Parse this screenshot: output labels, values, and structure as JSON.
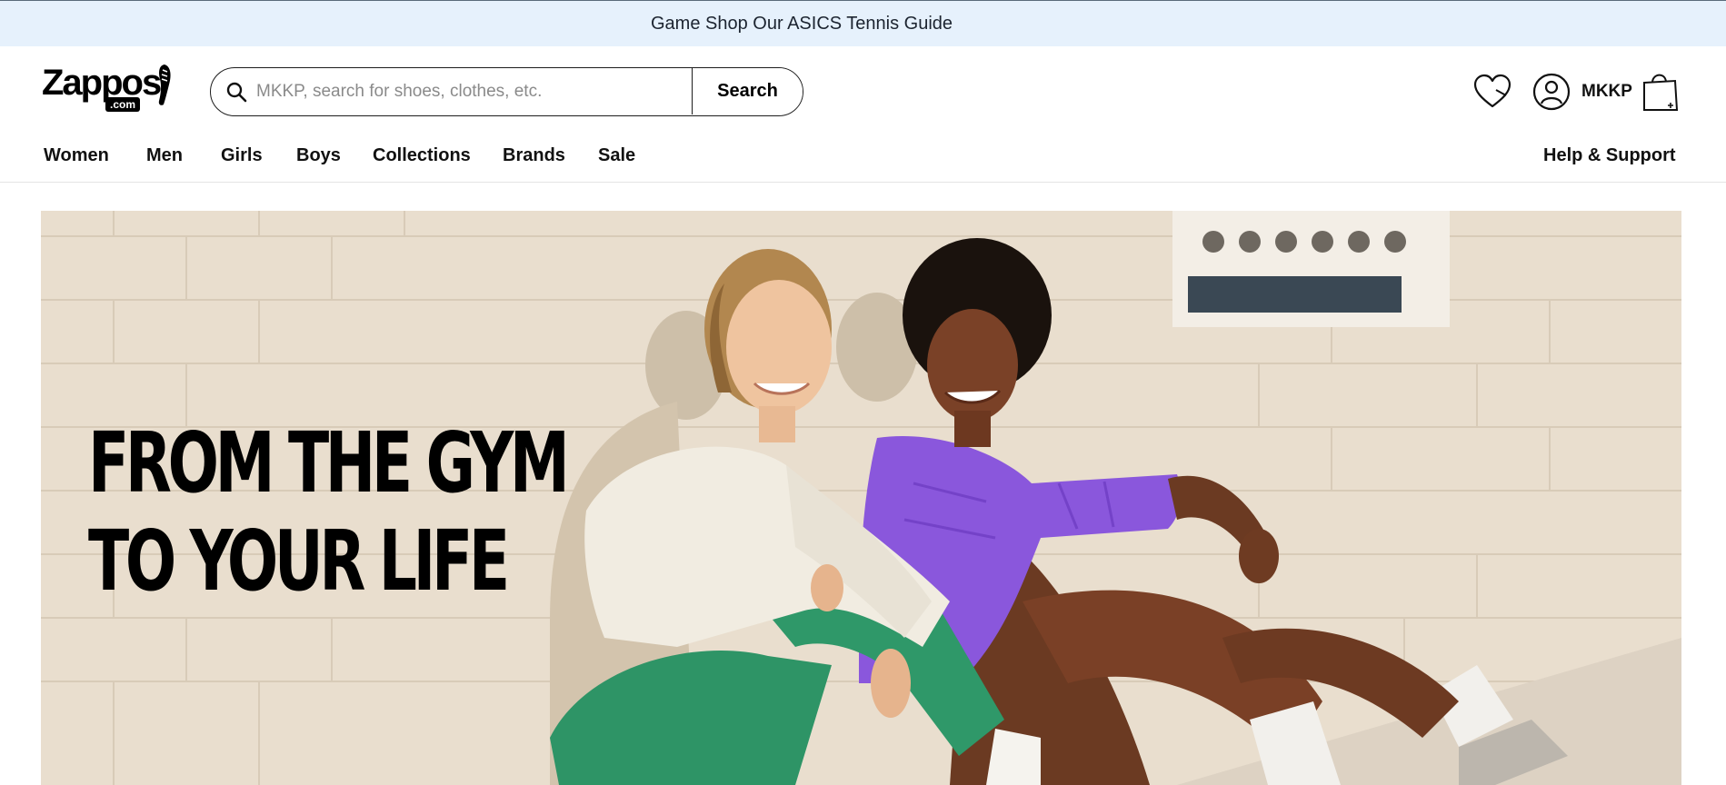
{
  "promo": {
    "link1": "Game Shop",
    "link2": "Our ASICS Tennis Guide"
  },
  "logo": {
    "word": "Zappos",
    "suffix": ".com"
  },
  "search": {
    "placeholder": "MKKP, search for shoes, clothes, etc.",
    "value": "",
    "button_label": "Search",
    "icon": "search-icon"
  },
  "account": {
    "name": "MKKP",
    "icon": "user-icon"
  },
  "icons": {
    "favorites": "heart-icon",
    "cart": "shopping-bag-icon"
  },
  "nav": {
    "items": [
      "Women",
      "Men",
      "Girls",
      "Boys",
      "Collections",
      "Brands",
      "Sale"
    ],
    "help": "Help & Support"
  },
  "hero": {
    "headline_line1": "FROM THE GYM",
    "headline_line2": "TO YOUR LIFE"
  },
  "colors": {
    "promo_bg": "#e6f1fc",
    "hero_wall": "#e8dccb",
    "leggings_green": "#2e9466",
    "jacket_purple": "#8655d9"
  }
}
